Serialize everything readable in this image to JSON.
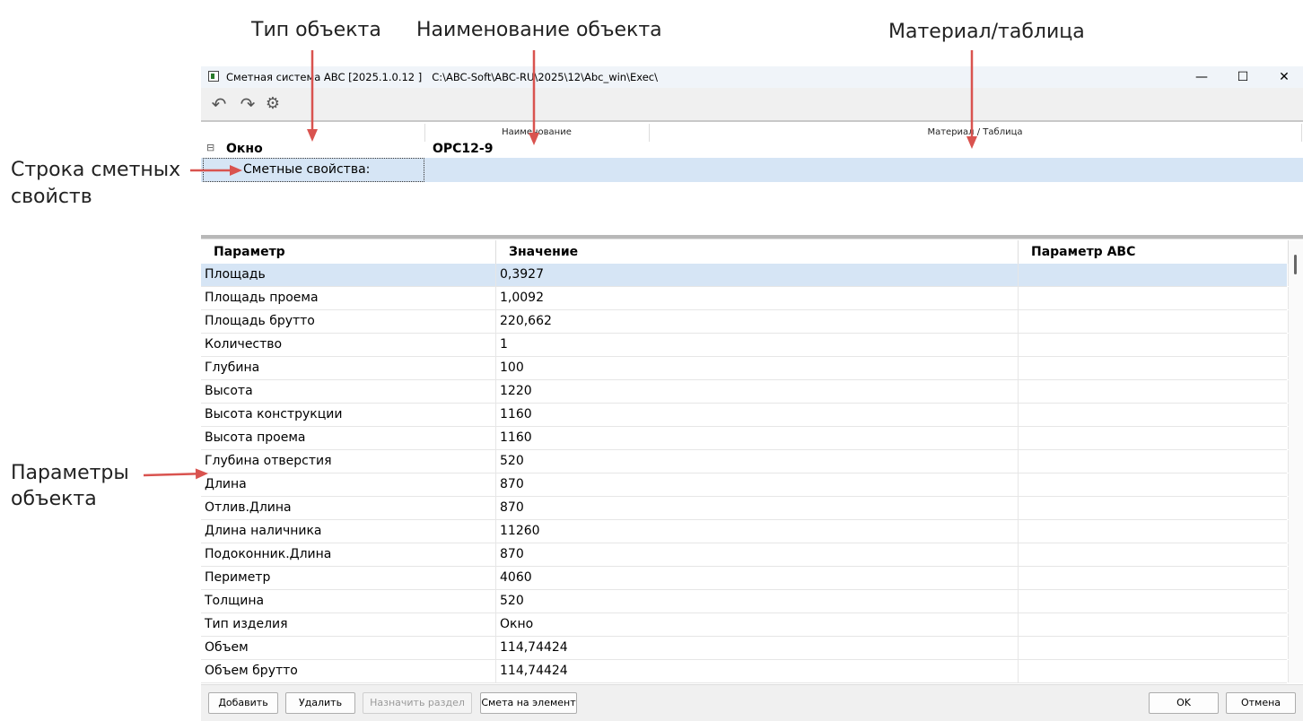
{
  "annotations": {
    "type": "Тип объекта",
    "name": "Наименование объекта",
    "material": "Материал/таблица",
    "estimate_row_1": "Строка сметных",
    "estimate_row_2": "свойств",
    "params_1": "Параметры",
    "params_2": "объекта",
    "arrow_color": "#d9534f"
  },
  "window": {
    "title": "Сметная система ABC [2025.1.0.12 ]   C:\\ABC-Soft\\ABC-RU\\2025\\12\\Abc_win\\Exec\\",
    "minimize": "—",
    "maximize": "☐",
    "close": "✕"
  },
  "toolbar": {
    "undo_icon": "undo-icon",
    "redo_icon": "redo-icon",
    "settings_icon": "gears-icon"
  },
  "tree": {
    "headers": [
      "",
      "Наименование",
      "Материал / Таблица"
    ],
    "expander": "⊟",
    "object_type": "Окно",
    "object_name": "ОРС12-9",
    "estimate_props": "Сметные свойства:",
    "selection_color": "#d6e5f5"
  },
  "grid": {
    "headers": [
      "Параметр",
      "Значение",
      "Параметр ABC"
    ],
    "rows": [
      [
        "Площадь",
        "0,3927",
        ""
      ],
      [
        "Площадь проема",
        "1,0092",
        ""
      ],
      [
        "Площадь брутто",
        "220,662",
        ""
      ],
      [
        "Количество",
        "1",
        ""
      ],
      [
        "Глубина",
        "100",
        ""
      ],
      [
        "Высота",
        "1220",
        ""
      ],
      [
        "Высота конструкции",
        "1160",
        ""
      ],
      [
        "Высота проема",
        "1160",
        ""
      ],
      [
        "Глубина отверстия",
        "520",
        ""
      ],
      [
        "Длина",
        "870",
        ""
      ],
      [
        "Отлив.Длина",
        "870",
        ""
      ],
      [
        "Длина наличника",
        "11260",
        ""
      ],
      [
        "Подоконник.Длина",
        "870",
        ""
      ],
      [
        "Периметр",
        "4060",
        ""
      ],
      [
        "Толщина",
        "520",
        ""
      ],
      [
        "Тип изделия",
        "Окно",
        ""
      ],
      [
        "Объем",
        "114,74424",
        ""
      ],
      [
        "Объем брутто",
        "114,74424",
        ""
      ]
    ]
  },
  "footer": {
    "add": "Добавить",
    "delete": "Удалить",
    "assign_section": "Назначить раздел",
    "estimate_for_element": "Смета на элемент",
    "ok": "OK",
    "cancel": "Отмена"
  }
}
